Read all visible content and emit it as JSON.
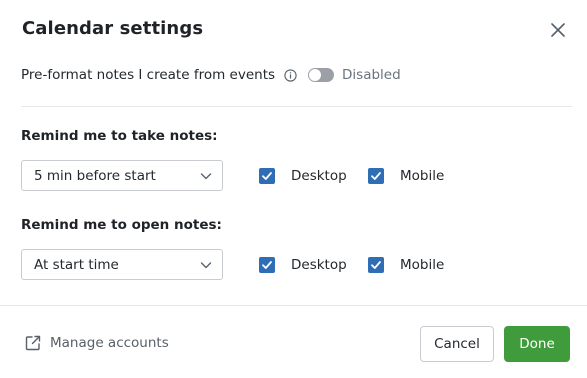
{
  "dialog": {
    "title": "Calendar settings"
  },
  "preformat": {
    "label": "Pre-format notes I create from events",
    "toggle_state": "Disabled",
    "enabled": false
  },
  "remind_take": {
    "label": "Remind me to take notes:",
    "select_value": "5 min before start",
    "desktop_label": "Desktop",
    "desktop_checked": true,
    "mobile_label": "Mobile",
    "mobile_checked": true
  },
  "remind_open": {
    "label": "Remind me to open notes:",
    "select_value": "At start time",
    "desktop_label": "Desktop",
    "desktop_checked": true,
    "mobile_label": "Mobile",
    "mobile_checked": true
  },
  "footer": {
    "manage_label": "Manage accounts",
    "cancel_label": "Cancel",
    "done_label": "Done"
  },
  "colors": {
    "primary_button": "#3f9b3c",
    "checkbox": "#2f6eb5",
    "toggle_off": "#9aa0a6"
  },
  "icons": {
    "close": "close-icon",
    "info": "info-icon",
    "chevron": "chevron-down-icon",
    "check": "check-icon",
    "external": "external-link-icon"
  }
}
